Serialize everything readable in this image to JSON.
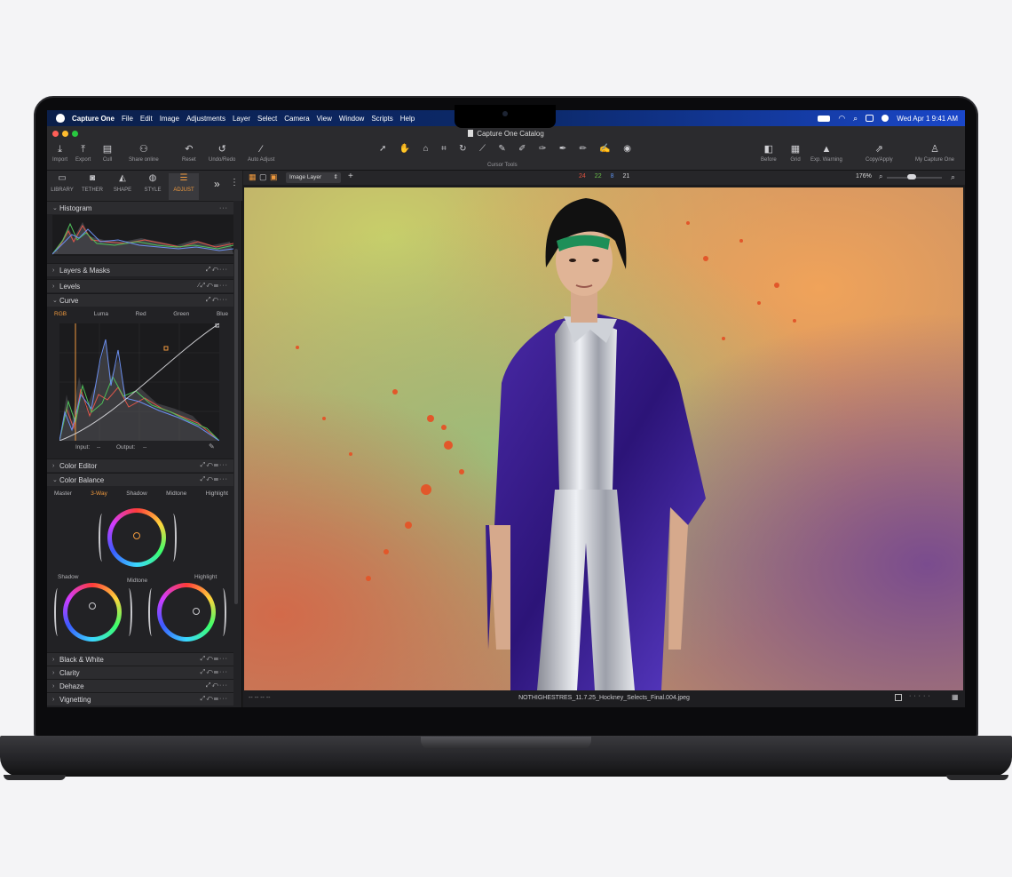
{
  "menubar": {
    "app": "Capture One",
    "items": [
      "File",
      "Edit",
      "Image",
      "Adjustments",
      "Layer",
      "Select",
      "Camera",
      "View",
      "Window",
      "Scripts",
      "Help"
    ],
    "clock": "Wed Apr 1  9:41 AM"
  },
  "window": {
    "title": "Capture One Catalog"
  },
  "toolbar": {
    "left": [
      {
        "label": "Import",
        "icon": "download-icon"
      },
      {
        "label": "Export",
        "icon": "upload-icon"
      },
      {
        "label": "Cull",
        "icon": "cull-icon"
      },
      {
        "label": "Share online",
        "icon": "people-icon"
      },
      {
        "label": "Reset",
        "icon": "reset-icon"
      },
      {
        "label": "Undo/Redo",
        "icon": "undo-icon"
      },
      {
        "label": "Auto Adjust",
        "icon": "magic-wand-icon"
      }
    ],
    "cursor_tools_label": "Cursor Tools",
    "right": [
      {
        "label": "Before",
        "icon": "before-after-icon"
      },
      {
        "label": "Grid",
        "icon": "grid-icon"
      },
      {
        "label": "Exp. Warning",
        "icon": "warning-icon"
      },
      {
        "label": "Copy/Apply",
        "icon": "copy-apply-icon"
      },
      {
        "label": "My Capture One",
        "icon": "person-icon"
      }
    ]
  },
  "panel_tabs": [
    {
      "label": "LIBRARY",
      "icon": "folder-icon"
    },
    {
      "label": "TETHER",
      "icon": "camera-icon"
    },
    {
      "label": "SHAPE",
      "icon": "shape-icon"
    },
    {
      "label": "STYLE",
      "icon": "palette-icon"
    },
    {
      "label": "ADJUST",
      "icon": "sliders-icon",
      "active": true
    }
  ],
  "sections": {
    "histogram": "Histogram",
    "layers": "Layers & Masks",
    "levels": "Levels",
    "curve": "Curve",
    "curve_tabs": [
      "RGB",
      "Luma",
      "Red",
      "Green",
      "Blue"
    ],
    "curve_input": "Input:",
    "curve_input_val": "--",
    "curve_output": "Output:",
    "curve_output_val": "--",
    "color_editor": "Color Editor",
    "color_balance": "Color Balance",
    "balance_tabs": [
      "Master",
      "3-Way",
      "Shadow",
      "Midtone",
      "Highlight"
    ],
    "shadow": "Shadow",
    "midtone": "Midtone",
    "highlight": "Highlight",
    "black_white": "Black & White",
    "clarity": "Clarity",
    "dehaze": "Dehaze",
    "vignetting": "Vignetting"
  },
  "viewer": {
    "layer": "Image Layer",
    "counts": [
      {
        "v": "24",
        "c": "#e2533f"
      },
      {
        "v": "22",
        "c": "#6cc24a"
      },
      {
        "v": "8",
        "c": "#5c8ee6"
      },
      {
        "v": "21",
        "c": "#d8d8dc"
      }
    ],
    "zoom": "176%",
    "zoom_level": 0.45
  },
  "status": {
    "filename": "NOTHIGHESTRES_11.7.25_Hockney_Selects_Final.004.jpeg"
  }
}
